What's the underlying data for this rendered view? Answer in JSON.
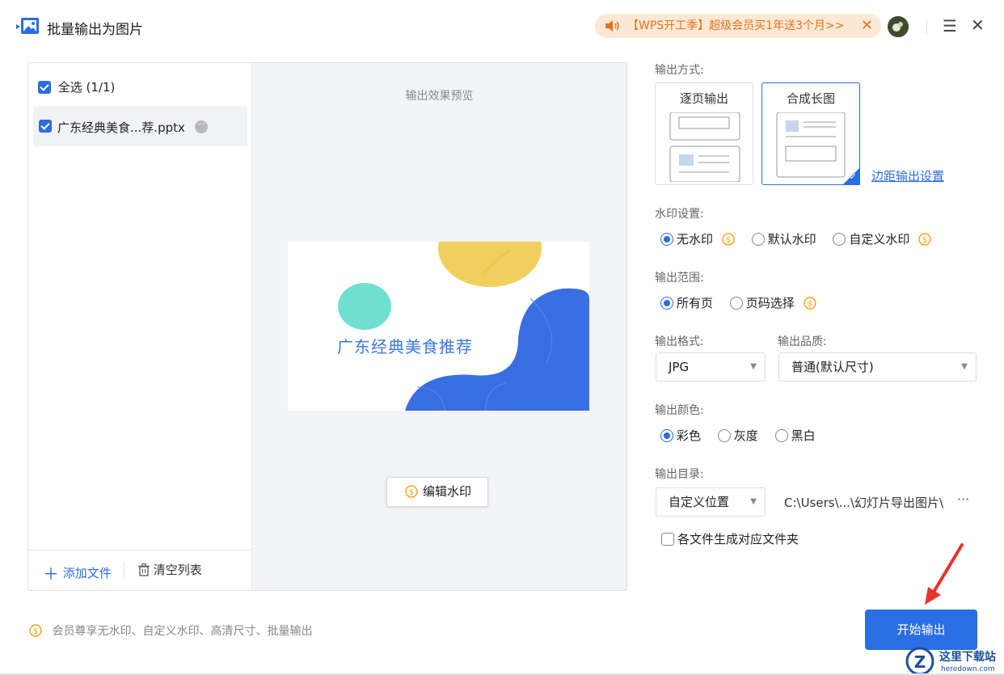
{
  "window": {
    "title": "批量输出为图片",
    "promo_text": "【WPS开工季】超级会员买1年送3个月>>",
    "icons": {
      "app": "image-export-icon",
      "promo": "speaker-icon",
      "promo_close": "close-icon",
      "menu": "menu-icon",
      "close": "close-icon"
    }
  },
  "file_panel": {
    "select_all_label": "全选 (1/1)",
    "files": [
      {
        "name": "广东经典美食...荐.pptx",
        "checked": true
      }
    ],
    "add_file_label": "添加文件",
    "clear_list_label": "清空列表"
  },
  "preview": {
    "title": "输出效果预览",
    "slide_title": "广东经典美食推荐",
    "edit_watermark_label": "编辑水印"
  },
  "settings": {
    "output_mode_label": "输出方式:",
    "mode_options": [
      "逐页输出",
      "合成长图"
    ],
    "mode_selected": "合成长图",
    "margin_link_label": "边距输出设置",
    "watermark_label": "水印设置:",
    "watermark_options": [
      "无水印",
      "默认水印",
      "自定义水印"
    ],
    "watermark_selected": "无水印",
    "range_label": "输出范围:",
    "range_options": [
      "所有页",
      "页码选择"
    ],
    "range_selected": "所有页",
    "format_label": "输出格式:",
    "format_value": "JPG",
    "quality_label": "输出品质:",
    "quality_value": "普通(默认尺寸)",
    "color_label": "输出颜色:",
    "color_options": [
      "彩色",
      "灰度",
      "黑白"
    ],
    "color_selected": "彩色",
    "dir_label": "输出目录:",
    "dir_mode_value": "自定义位置",
    "dir_path": "C:\\Users\\...\\幻灯片导出图片\\",
    "dir_more": "···",
    "folder_option_label": "各文件生成对应文件夹",
    "folder_option_checked": false
  },
  "footer": {
    "member_note": "会员尊享无水印、自定义水印、高清尺寸、批量输出",
    "start_button": "开始输出"
  },
  "colors": {
    "accent": "#2b6de3",
    "promo_bg": "#fbe9d6",
    "promo_text": "#e8731a",
    "coin": "#f5a623"
  }
}
